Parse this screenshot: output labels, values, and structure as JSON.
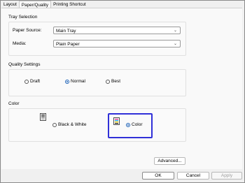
{
  "tabs": [
    "Layout",
    "Paper/Quality",
    "Printing Shortcut"
  ],
  "tray_selection": {
    "title": "Tray Selection",
    "paper_source_label": "Paper Source:",
    "paper_source_value": "Main Tray",
    "media_label": "Media:",
    "media_value": "Plain Paper"
  },
  "quality": {
    "title": "Quality Settings",
    "options": [
      "Draft",
      "Normal",
      "Best"
    ],
    "selected": "Normal"
  },
  "color": {
    "title": "Color",
    "options": [
      "Black & White",
      "Color"
    ],
    "selected": "Color"
  },
  "buttons": {
    "advanced": "Advanced...",
    "ok": "OK",
    "cancel": "Cancel",
    "apply": "Apply"
  },
  "colors": {
    "highlight": "#3030d8",
    "radio_selected": "#1a5fb4"
  }
}
